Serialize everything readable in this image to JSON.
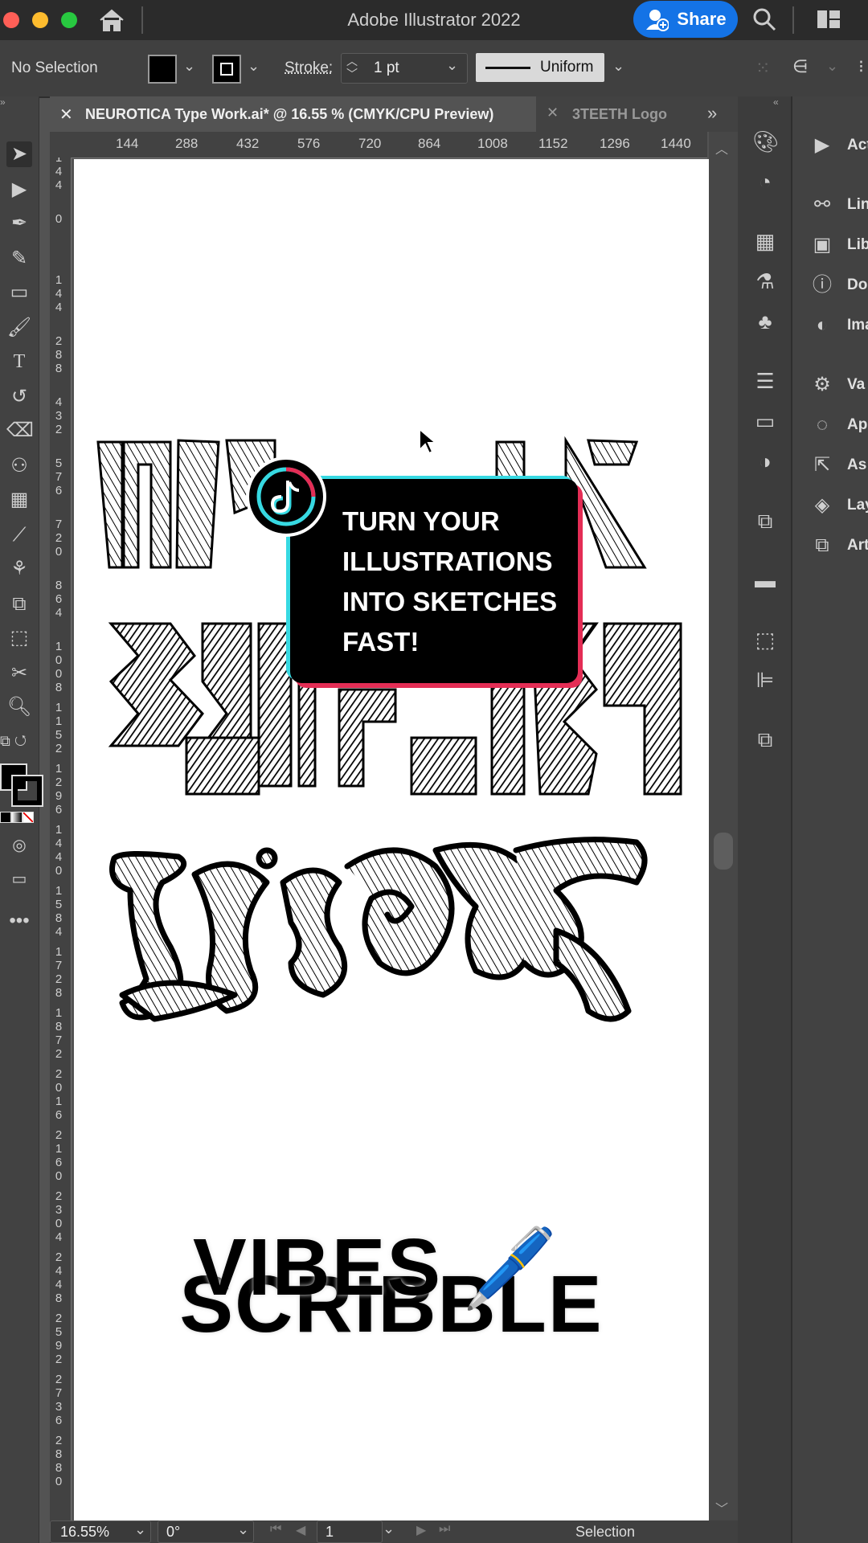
{
  "window": {
    "title": "Adobe Illustrator 2022",
    "share_label": "Share"
  },
  "control_bar": {
    "selection_label": "No Selection",
    "stroke_label": "Stroke:",
    "stroke_value": "1 pt",
    "profile_label": "Uniform"
  },
  "tabs": [
    {
      "label": "NEUROTICA Type Work.ai* @ 16.55 % (CMYK/CPU Preview)",
      "active": true
    },
    {
      "label": "3TEETH Logo",
      "active": false
    }
  ],
  "ruler": {
    "horizontal": [
      "144",
      "288",
      "432",
      "576",
      "720",
      "864",
      "1008",
      "1152",
      "1296",
      "1440"
    ],
    "vertical": [
      "144",
      "0",
      "144",
      "288",
      "432",
      "576",
      "720",
      "864",
      "1008",
      "1152",
      "1296",
      "1440",
      "1584",
      "1728",
      "1872",
      "2016",
      "2160",
      "2304",
      "2448",
      "2592",
      "2736",
      "2880"
    ]
  },
  "panels": [
    {
      "label": "Act",
      "icon": "play-icon"
    },
    {
      "label": "Lin",
      "icon": "link-icon"
    },
    {
      "label": "Lib",
      "icon": "library-icon"
    },
    {
      "label": "Do",
      "icon": "document-info-icon"
    },
    {
      "label": "Ima",
      "icon": "image-trace-icon"
    },
    {
      "label": "Va",
      "icon": "variables-icon"
    },
    {
      "label": "Ap",
      "icon": "appearance-icon"
    },
    {
      "label": "As",
      "icon": "asset-export-icon"
    },
    {
      "label": "Lay",
      "icon": "layers-icon"
    },
    {
      "label": "Art",
      "icon": "artboards-icon"
    }
  ],
  "overlay": {
    "lines": [
      "TURN YOUR",
      "ILLUSTRATIONS",
      "INTO SKETCHES",
      "FAST!"
    ]
  },
  "headline": {
    "line1": "SCRIBBLE",
    "line2": "VIBES",
    "emoji": "🖊️"
  },
  "status_bar": {
    "zoom": "16.55%",
    "rotation": "0°",
    "artboard_number": "1",
    "tool_label": "Selection"
  },
  "colors": {
    "share_blue": "#1473e6",
    "tiktok_cyan": "#37d9e2",
    "tiktok_red": "#e42d55"
  }
}
